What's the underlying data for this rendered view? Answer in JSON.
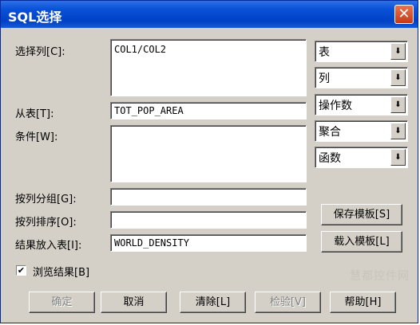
{
  "window": {
    "title": "SQL选择",
    "close_glyph": "✕"
  },
  "form": {
    "columns_label": "选择列[C]:",
    "columns_value": "COL1/COL2",
    "from_label": "从表[T]:",
    "from_value": "TOT_POP_AREA",
    "where_label": "条件[W]:",
    "where_value": "",
    "group_label": "按列分组[G]:",
    "group_value": "",
    "order_label": "按列排序[O]:",
    "order_value": "",
    "into_label": "结果放入表[I]:",
    "into_value": "WORLD_DENSITY"
  },
  "combos": [
    {
      "label": "表"
    },
    {
      "label": "列"
    },
    {
      "label": "操作数"
    },
    {
      "label": "聚合"
    },
    {
      "label": "函数"
    }
  ],
  "side_buttons": {
    "save_template": "保存模板[S]",
    "load_template": "载入模板[L]"
  },
  "browse_checkbox": {
    "label": "浏览结果[B]",
    "checked": true,
    "mark": "✔"
  },
  "footer_buttons": {
    "ok": "确定",
    "cancel": "取消",
    "clear": "清除[L]",
    "verify": "检验[V]",
    "help": "帮助[H]"
  },
  "watermark": "慧都控件网"
}
